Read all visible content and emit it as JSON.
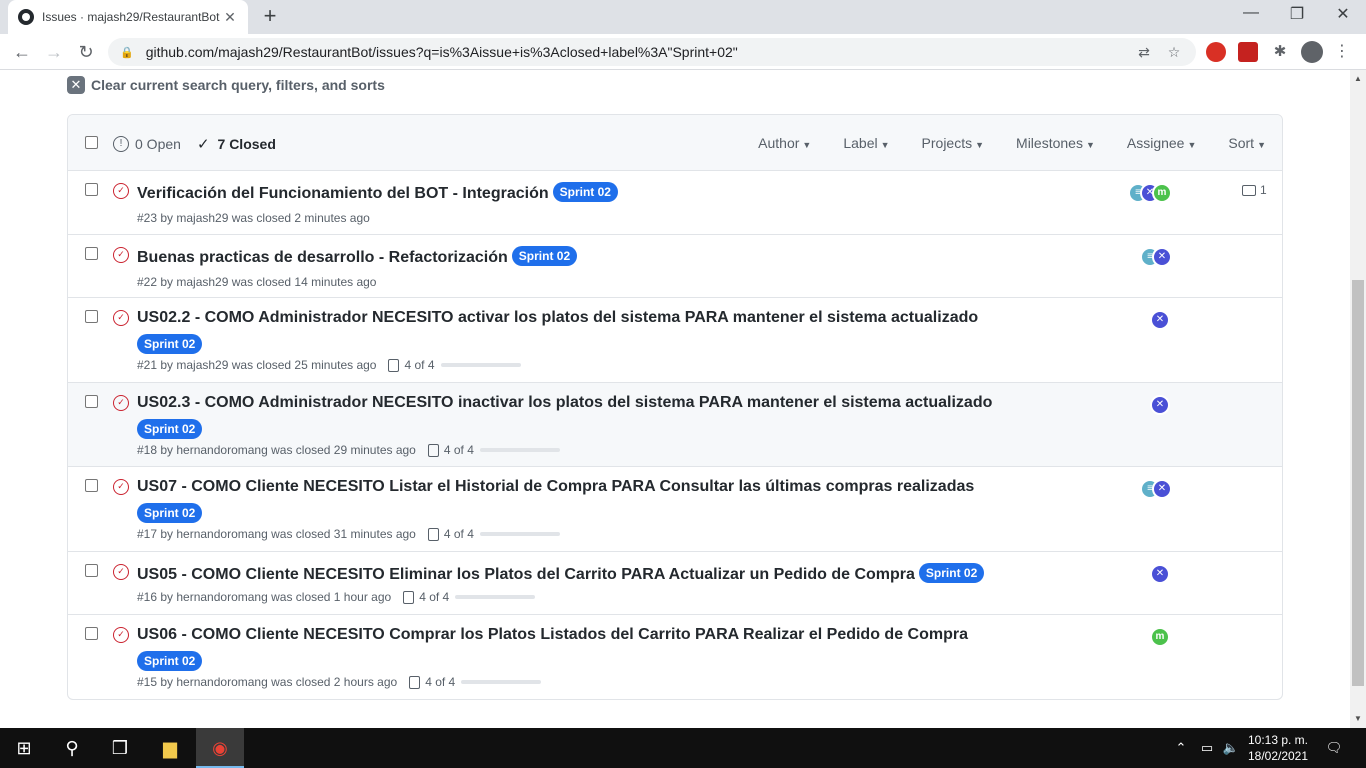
{
  "browser": {
    "tab_title": "Issues · majash29/RestaurantBot",
    "url": "github.com/majash29/RestaurantBot/issues?q=is%3Aissue+is%3Aclosed+label%3A\"Sprint+02\""
  },
  "clear_filter": "Clear current search query, filters, and sorts",
  "header": {
    "open_label": "0 Open",
    "closed_label": "7 Closed",
    "filters": [
      "Author",
      "Label",
      "Projects",
      "Milestones",
      "Assignee",
      "Sort"
    ]
  },
  "issues": [
    {
      "title": "Verificación del Funcionamiento del BOT - Integración",
      "label": "Sprint 02",
      "meta": "#23 by majash29 was closed 2 minutes ago",
      "comments": "1"
    },
    {
      "title": "Buenas practicas de desarrollo - Refactorización",
      "label": "Sprint 02",
      "meta": "#22 by majash29 was closed 14 minutes ago"
    },
    {
      "title": "US02.2 - COMO Administrador NECESITO activar los platos del sistema PARA mantener el sistema actualizado",
      "label": "Sprint 02",
      "meta": "#21 by majash29 was closed 25 minutes ago",
      "tasks": "4 of 4",
      "progress": 1.0
    },
    {
      "title": "US02.3 - COMO Administrador NECESITO inactivar los platos del sistema PARA mantener el sistema actualizado",
      "label": "Sprint 02",
      "meta": "#18 by hernandoromang was closed 29 minutes ago",
      "tasks": "4 of 4",
      "progress": 1.0
    },
    {
      "title": "US07 - COMO Cliente NECESITO Listar el Historial de Compra PARA Consultar las últimas compras realizadas",
      "label": "Sprint 02",
      "meta": "#17 by hernandoromang was closed 31 minutes ago",
      "tasks": "4 of 4",
      "progress": 1.0
    },
    {
      "title": "US05 - COMO Cliente NECESITO Eliminar los Platos del Carrito PARA Actualizar un Pedido de Compra",
      "label": "Sprint 02",
      "meta": "#16 by hernandoromang was closed 1 hour ago",
      "tasks": "4 of 4",
      "progress": 1.0
    },
    {
      "title": "US06 - COMO Cliente NECESITO Comprar los Platos Listados del Carrito PARA Realizar el Pedido de Compra",
      "label": "Sprint 02",
      "meta": "#15 by hernandoromang was closed 2 hours ago",
      "tasks": "4 of 4",
      "progress": 1.0
    }
  ],
  "taskbar": {
    "time": "10:13 p. m.",
    "date": "18/02/2021"
  },
  "colors": {
    "label": "#1f6feb",
    "closed_icon": "#cb2431"
  }
}
